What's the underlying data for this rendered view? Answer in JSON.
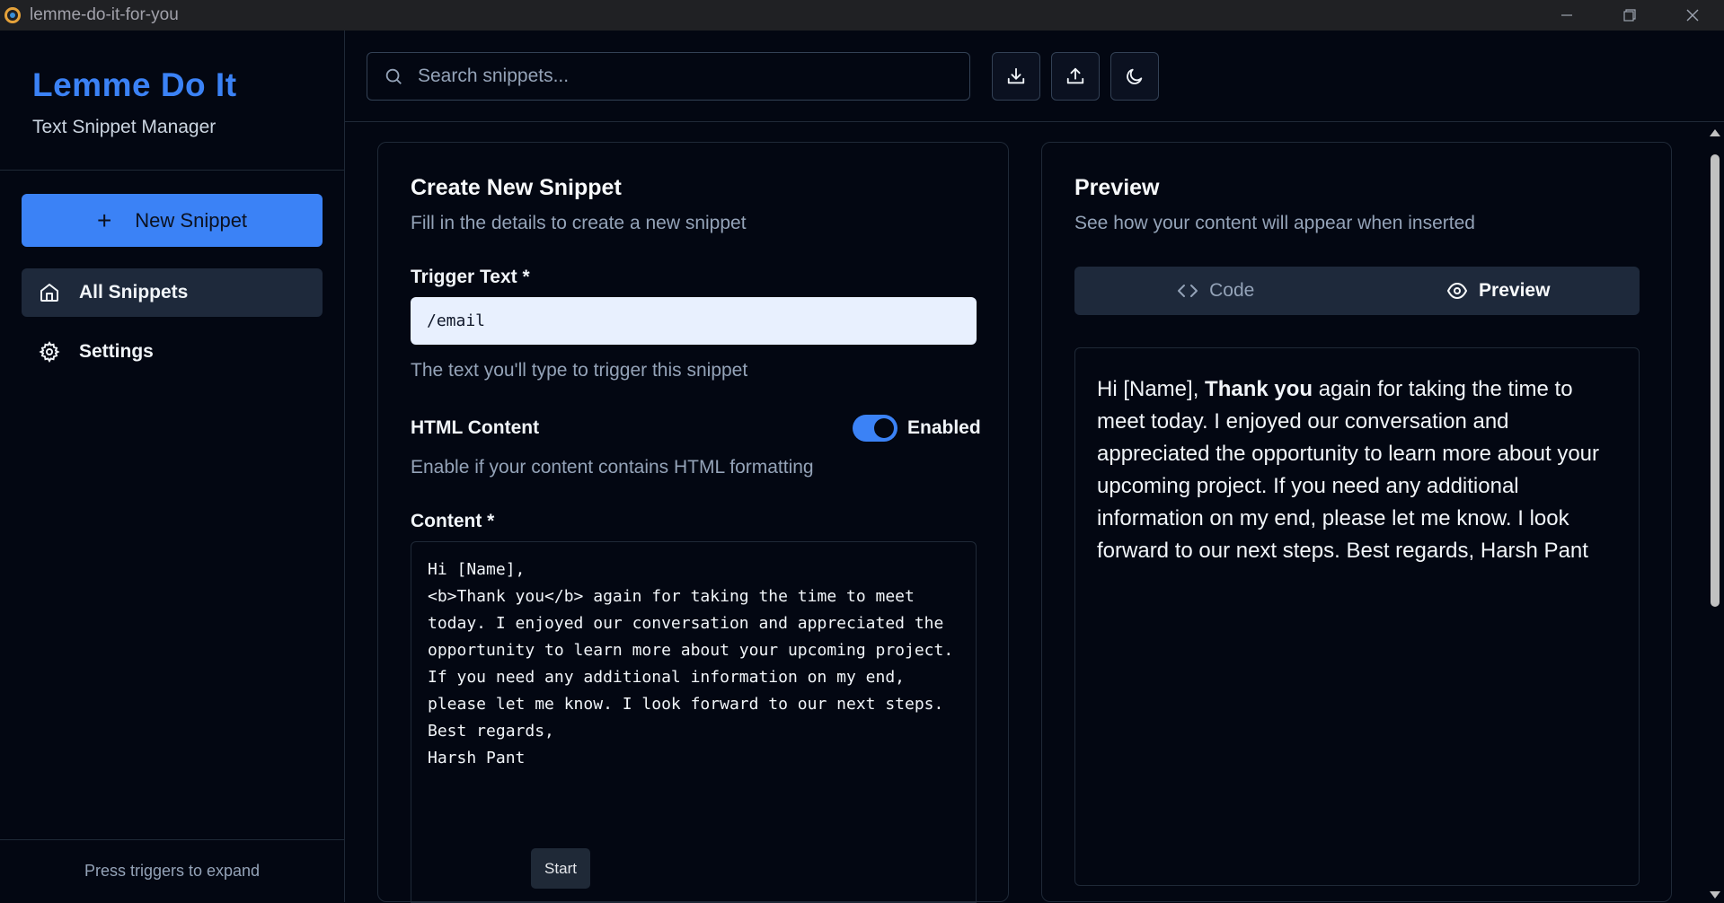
{
  "window": {
    "title": "lemme-do-it-for-you"
  },
  "sidebar": {
    "brand_name": "Lemme Do It",
    "brand_subtitle": "Text Snippet Manager",
    "new_button_label": "New Snippet",
    "items": [
      {
        "label": "All Snippets",
        "icon": "home-icon",
        "active": true
      },
      {
        "label": "Settings",
        "icon": "gear-icon",
        "active": false
      }
    ],
    "footer": "Press triggers to expand"
  },
  "header": {
    "search_placeholder": "Search snippets...",
    "actions": [
      "download-icon",
      "upload-icon",
      "moon-icon"
    ]
  },
  "form": {
    "title": "Create New Snippet",
    "subtitle": "Fill in the details to create a new snippet",
    "trigger_label": "Trigger Text *",
    "trigger_value": "/email",
    "trigger_help": "The text you'll type to trigger this snippet",
    "html_label": "HTML Content",
    "html_toggle_label": "Enabled",
    "html_enabled": true,
    "html_help": "Enable if your content contains HTML formatting",
    "content_label": "Content *",
    "content_value": "Hi [Name],\n<b>Thank you</b> again for taking the time to meet today. I enjoyed our conversation and appreciated the opportunity to learn more about your upcoming project.\nIf you need any additional information on my end, please let me know. I look forward to our next steps.\nBest regards,\nHarsh Pant",
    "start_button": "Start"
  },
  "preview": {
    "title": "Preview",
    "subtitle": "See how your content will appear when inserted",
    "tab_code": "Code",
    "tab_preview": "Preview",
    "active_tab": "Preview",
    "text_before": "Hi [Name], ",
    "text_bold": "Thank you",
    "text_after": " again for taking the time to meet today. I enjoyed our conversation and appreciated the opportunity to learn more about your upcoming project. If you need any additional information on my end, please let me know. I look forward to our next steps. Best regards, Harsh Pant"
  },
  "colors": {
    "accent": "#3b82f6",
    "background": "#030712",
    "panel": "#1e293b"
  }
}
